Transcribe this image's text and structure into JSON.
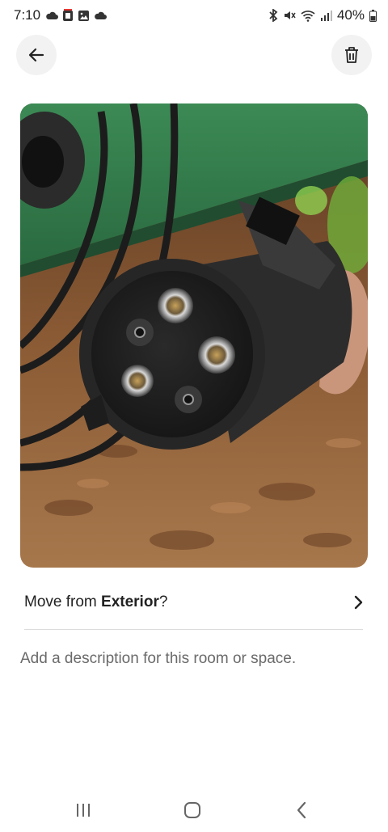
{
  "status_bar": {
    "time": "7:10",
    "battery": "40%",
    "left_icons": [
      "cloud-icon",
      "b-app-icon",
      "gallery-icon",
      "cloud-icon"
    ],
    "right_icons": [
      "bluetooth-icon",
      "mute-icon",
      "wifi-icon",
      "signal-icon",
      "battery-icon"
    ]
  },
  "header": {
    "back_icon": "arrow-left-icon",
    "delete_icon": "trash-icon"
  },
  "photo": {
    "icon": "photo-ev-charger-connector"
  },
  "move_row": {
    "prefix": "Move from ",
    "room": "Exterior",
    "suffix": "?",
    "chevron": "chevron-right-icon"
  },
  "description": {
    "placeholder": "Add a description for this room or space."
  },
  "nav_bar": {
    "icons": [
      "recents-icon",
      "home-icon",
      "back-icon"
    ]
  },
  "colors": {
    "accent_text": "#222222",
    "placeholder": "#6a6a6a",
    "button_bg": "#f2f2f2"
  }
}
